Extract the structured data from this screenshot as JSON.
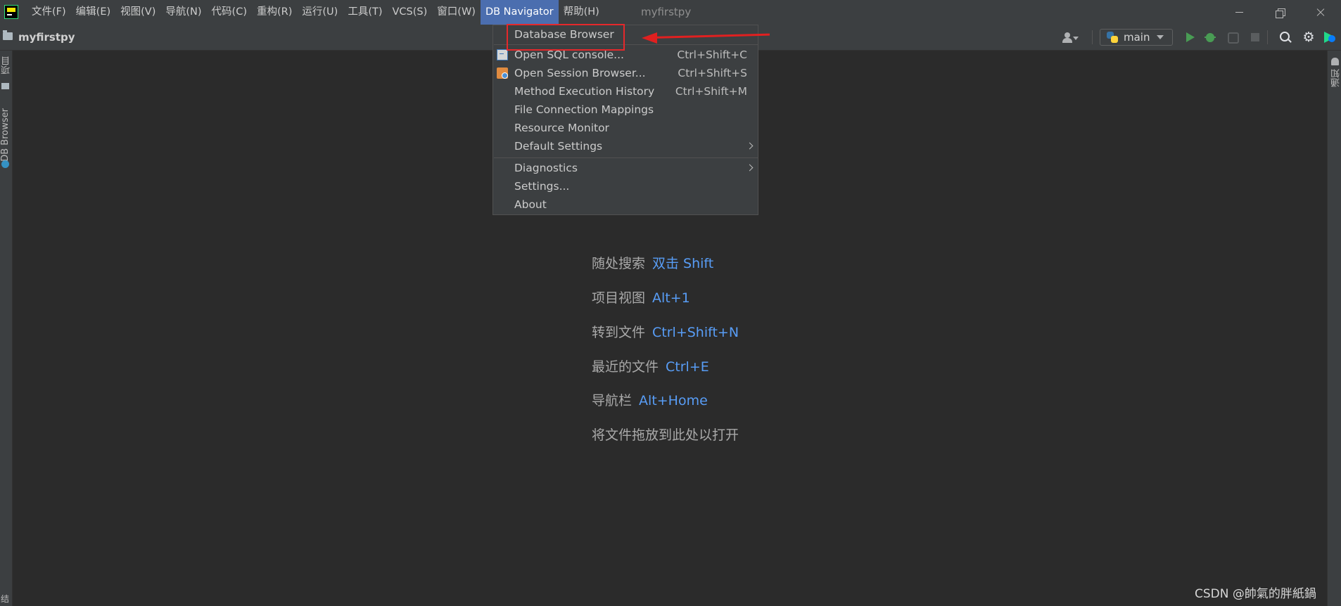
{
  "menubar": {
    "items": [
      "文件(F)",
      "编辑(E)",
      "视图(V)",
      "导航(N)",
      "代码(C)",
      "重构(R)",
      "运行(U)",
      "工具(T)",
      "VCS(S)",
      "窗口(W)",
      "DB Navigator",
      "帮助(H)"
    ],
    "active_index": 10,
    "window_title": "myfirstpy"
  },
  "navbar": {
    "project": "myfirstpy",
    "run_config": "main"
  },
  "sidebar_left": {
    "project_tab": "项目",
    "db_browser_tab": "DB Browser",
    "bottom_label": "结"
  },
  "sidebar_right": {
    "notifications_tab": "通知"
  },
  "dropdown": {
    "items": [
      {
        "label": "Database Browser",
        "shortcut": "",
        "icon": "",
        "submenu": false
      },
      {
        "label": "Open SQL console...",
        "shortcut": "Ctrl+Shift+C",
        "icon": "sql-console-icon",
        "submenu": false
      },
      {
        "label": "Open Session Browser...",
        "shortcut": "Ctrl+Shift+S",
        "icon": "session-browser-icon",
        "submenu": false
      },
      {
        "label": "Method Execution History",
        "shortcut": "Ctrl+Shift+M",
        "icon": "",
        "submenu": false
      },
      {
        "label": "File Connection Mappings",
        "shortcut": "",
        "icon": "",
        "submenu": false
      },
      {
        "label": "Resource Monitor",
        "shortcut": "",
        "icon": "",
        "submenu": false
      },
      {
        "label": "Default Settings",
        "shortcut": "",
        "icon": "",
        "submenu": true
      },
      {
        "label": "Diagnostics",
        "shortcut": "",
        "icon": "",
        "submenu": true
      },
      {
        "label": "Settings...",
        "shortcut": "",
        "icon": "",
        "submenu": false
      },
      {
        "label": "About",
        "shortcut": "",
        "icon": "",
        "submenu": false
      }
    ]
  },
  "editor_hints": [
    {
      "label": "随处搜索",
      "key": "双击 Shift"
    },
    {
      "label": "项目视图",
      "key": "Alt+1"
    },
    {
      "label": "转到文件",
      "key": "Ctrl+Shift+N"
    },
    {
      "label": "最近的文件",
      "key": "Ctrl+E"
    },
    {
      "label": "导航栏",
      "key": "Alt+Home"
    },
    {
      "label": "将文件拖放到此处以打开",
      "key": ""
    }
  ],
  "annotation": {
    "highlight_color": "#e5282b"
  },
  "watermark": "CSDN @帥氣的胖紙鍋",
  "colors": {
    "background": "#2b2b2b",
    "chrome": "#3c3f41",
    "accent": "#4b6eaf",
    "link_key": "#589df6",
    "run_green": "#499c54"
  }
}
